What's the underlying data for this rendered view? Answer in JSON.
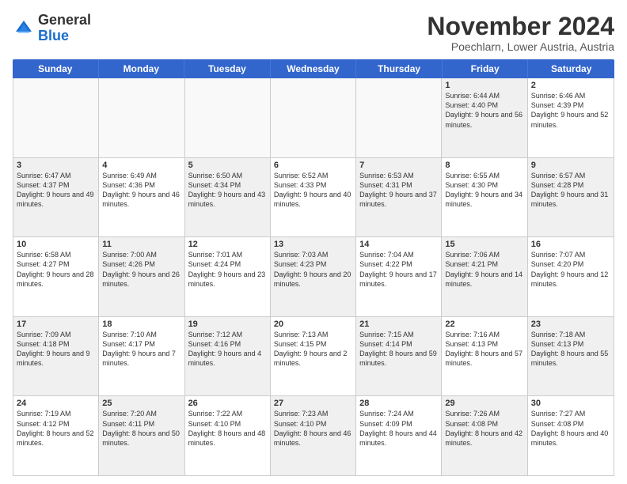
{
  "logo": {
    "general": "General",
    "blue": "Blue"
  },
  "title": "November 2024",
  "location": "Poechlarn, Lower Austria, Austria",
  "headers": [
    "Sunday",
    "Monday",
    "Tuesday",
    "Wednesday",
    "Thursday",
    "Friday",
    "Saturday"
  ],
  "weeks": [
    [
      {
        "day": "",
        "info": "",
        "empty": true
      },
      {
        "day": "",
        "info": "",
        "empty": true
      },
      {
        "day": "",
        "info": "",
        "empty": true
      },
      {
        "day": "",
        "info": "",
        "empty": true
      },
      {
        "day": "",
        "info": "",
        "empty": true
      },
      {
        "day": "1",
        "info": "Sunrise: 6:44 AM\nSunset: 4:40 PM\nDaylight: 9 hours and 56 minutes.",
        "shaded": true
      },
      {
        "day": "2",
        "info": "Sunrise: 6:46 AM\nSunset: 4:39 PM\nDaylight: 9 hours and 52 minutes.",
        "shaded": false
      }
    ],
    [
      {
        "day": "3",
        "info": "Sunrise: 6:47 AM\nSunset: 4:37 PM\nDaylight: 9 hours and 49 minutes.",
        "shaded": true
      },
      {
        "day": "4",
        "info": "Sunrise: 6:49 AM\nSunset: 4:36 PM\nDaylight: 9 hours and 46 minutes.",
        "shaded": false
      },
      {
        "day": "5",
        "info": "Sunrise: 6:50 AM\nSunset: 4:34 PM\nDaylight: 9 hours and 43 minutes.",
        "shaded": true
      },
      {
        "day": "6",
        "info": "Sunrise: 6:52 AM\nSunset: 4:33 PM\nDaylight: 9 hours and 40 minutes.",
        "shaded": false
      },
      {
        "day": "7",
        "info": "Sunrise: 6:53 AM\nSunset: 4:31 PM\nDaylight: 9 hours and 37 minutes.",
        "shaded": true
      },
      {
        "day": "8",
        "info": "Sunrise: 6:55 AM\nSunset: 4:30 PM\nDaylight: 9 hours and 34 minutes.",
        "shaded": false
      },
      {
        "day": "9",
        "info": "Sunrise: 6:57 AM\nSunset: 4:28 PM\nDaylight: 9 hours and 31 minutes.",
        "shaded": true
      }
    ],
    [
      {
        "day": "10",
        "info": "Sunrise: 6:58 AM\nSunset: 4:27 PM\nDaylight: 9 hours and 28 minutes.",
        "shaded": false
      },
      {
        "day": "11",
        "info": "Sunrise: 7:00 AM\nSunset: 4:26 PM\nDaylight: 9 hours and 26 minutes.",
        "shaded": true
      },
      {
        "day": "12",
        "info": "Sunrise: 7:01 AM\nSunset: 4:24 PM\nDaylight: 9 hours and 23 minutes.",
        "shaded": false
      },
      {
        "day": "13",
        "info": "Sunrise: 7:03 AM\nSunset: 4:23 PM\nDaylight: 9 hours and 20 minutes.",
        "shaded": true
      },
      {
        "day": "14",
        "info": "Sunrise: 7:04 AM\nSunset: 4:22 PM\nDaylight: 9 hours and 17 minutes.",
        "shaded": false
      },
      {
        "day": "15",
        "info": "Sunrise: 7:06 AM\nSunset: 4:21 PM\nDaylight: 9 hours and 14 minutes.",
        "shaded": true
      },
      {
        "day": "16",
        "info": "Sunrise: 7:07 AM\nSunset: 4:20 PM\nDaylight: 9 hours and 12 minutes.",
        "shaded": false
      }
    ],
    [
      {
        "day": "17",
        "info": "Sunrise: 7:09 AM\nSunset: 4:18 PM\nDaylight: 9 hours and 9 minutes.",
        "shaded": true
      },
      {
        "day": "18",
        "info": "Sunrise: 7:10 AM\nSunset: 4:17 PM\nDaylight: 9 hours and 7 minutes.",
        "shaded": false
      },
      {
        "day": "19",
        "info": "Sunrise: 7:12 AM\nSunset: 4:16 PM\nDaylight: 9 hours and 4 minutes.",
        "shaded": true
      },
      {
        "day": "20",
        "info": "Sunrise: 7:13 AM\nSunset: 4:15 PM\nDaylight: 9 hours and 2 minutes.",
        "shaded": false
      },
      {
        "day": "21",
        "info": "Sunrise: 7:15 AM\nSunset: 4:14 PM\nDaylight: 8 hours and 59 minutes.",
        "shaded": true
      },
      {
        "day": "22",
        "info": "Sunrise: 7:16 AM\nSunset: 4:13 PM\nDaylight: 8 hours and 57 minutes.",
        "shaded": false
      },
      {
        "day": "23",
        "info": "Sunrise: 7:18 AM\nSunset: 4:13 PM\nDaylight: 8 hours and 55 minutes.",
        "shaded": true
      }
    ],
    [
      {
        "day": "24",
        "info": "Sunrise: 7:19 AM\nSunset: 4:12 PM\nDaylight: 8 hours and 52 minutes.",
        "shaded": false
      },
      {
        "day": "25",
        "info": "Sunrise: 7:20 AM\nSunset: 4:11 PM\nDaylight: 8 hours and 50 minutes.",
        "shaded": true
      },
      {
        "day": "26",
        "info": "Sunrise: 7:22 AM\nSunset: 4:10 PM\nDaylight: 8 hours and 48 minutes.",
        "shaded": false
      },
      {
        "day": "27",
        "info": "Sunrise: 7:23 AM\nSunset: 4:10 PM\nDaylight: 8 hours and 46 minutes.",
        "shaded": true
      },
      {
        "day": "28",
        "info": "Sunrise: 7:24 AM\nSunset: 4:09 PM\nDaylight: 8 hours and 44 minutes.",
        "shaded": false
      },
      {
        "day": "29",
        "info": "Sunrise: 7:26 AM\nSunset: 4:08 PM\nDaylight: 8 hours and 42 minutes.",
        "shaded": true
      },
      {
        "day": "30",
        "info": "Sunrise: 7:27 AM\nSunset: 4:08 PM\nDaylight: 8 hours and 40 minutes.",
        "shaded": false
      }
    ]
  ]
}
